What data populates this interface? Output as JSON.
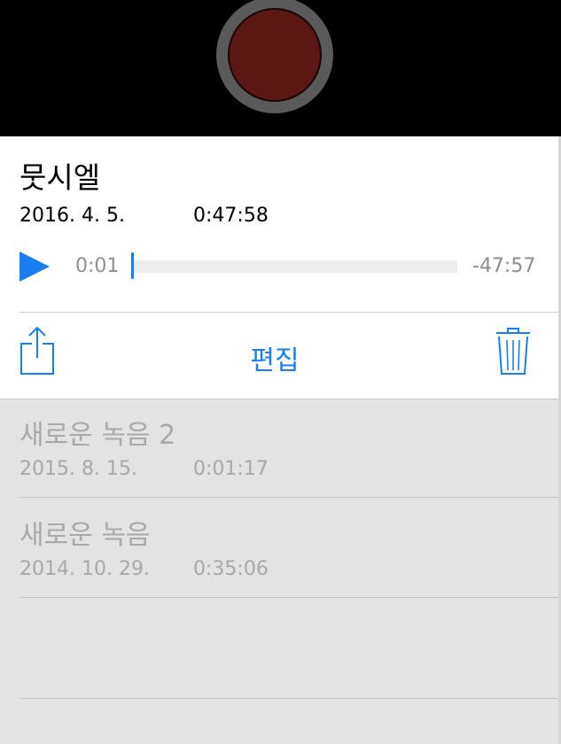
{
  "active_recording": {
    "title": "뭇시엘",
    "date": "2016. 4. 5.",
    "duration": "0:47:58",
    "elapsed": "0:01",
    "remaining": "-47:57",
    "progress_fraction": 0.0003
  },
  "actions": {
    "edit_label": "편집",
    "share_icon": "share-icon",
    "trash_icon": "trash-icon",
    "play_icon": "play-icon"
  },
  "recordings": [
    {
      "title": "새로운 녹음 2",
      "date": "2015. 8. 15.",
      "duration": "0:01:17"
    },
    {
      "title": "새로운 녹음",
      "date": "2014. 10. 29.",
      "duration": "0:35:06"
    }
  ],
  "colors": {
    "accent": "#1a7ef2",
    "record_fill": "#5a1714",
    "record_ring": "#5a5a5a",
    "list_background": "#e3e3e3",
    "list_text": "#a9a9a9"
  }
}
